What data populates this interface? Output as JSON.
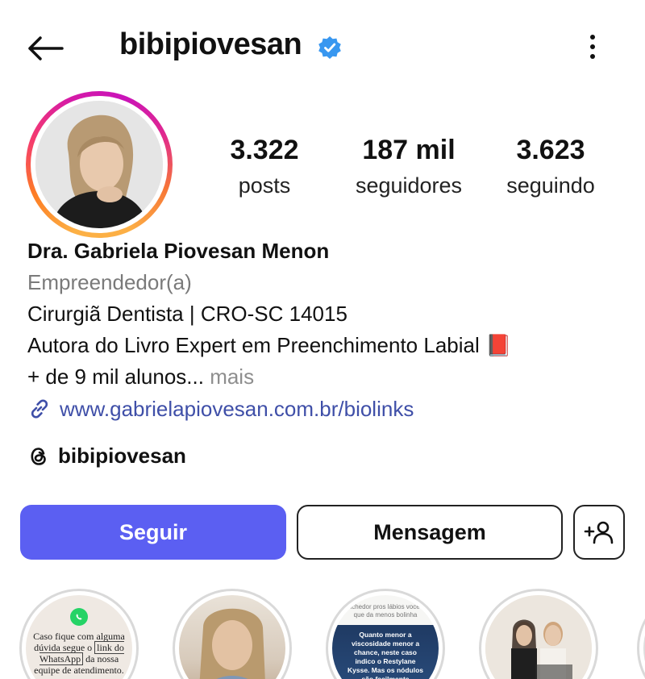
{
  "header": {
    "username": "bibipiovesan",
    "back_label": "Voltar"
  },
  "stats": [
    {
      "value": "3.322",
      "label": "posts"
    },
    {
      "value": "187 mil",
      "label": "seguidores"
    },
    {
      "value": "3.623",
      "label": "seguindo"
    }
  ],
  "bio": {
    "name": "Dra. Gabriela Piovesan Menon",
    "category": "Empreendedor(a)",
    "line1": "Cirurgiã Dentista | CRO-SC 14015",
    "line2": "Autora do Livro Expert em Preenchimento Labial 📕",
    "line3": "+ de 9 mil alunos...",
    "more": " mais",
    "link": "www.gabrielapiovesan.com.br/biolinks"
  },
  "threads": {
    "handle": "bibipiovesan"
  },
  "actions": {
    "follow": "Seguir",
    "message": "Mensagem"
  },
  "highlights": {
    "h1_text_a": "Caso fique com alguma dúvida segue o",
    "h1_text_b": "link do WhatsApp",
    "h1_text_c": "da nossa equipe de atendimento.",
    "h3_top": "preenchedor pros lábios você acha que da menos bolinha",
    "h3_text": "Quanto menor a viscosidade menor a chance, neste caso indico o Restylane Kysse. Mas os nódulos são facilmente resolvidos, vou dar uma aula sobre isso na Semana do"
  },
  "colors": {
    "follow_button": "#5b5ff2",
    "verified_badge": "#3897f0",
    "link": "#3f4fa8",
    "category": "#7a7a7a"
  }
}
